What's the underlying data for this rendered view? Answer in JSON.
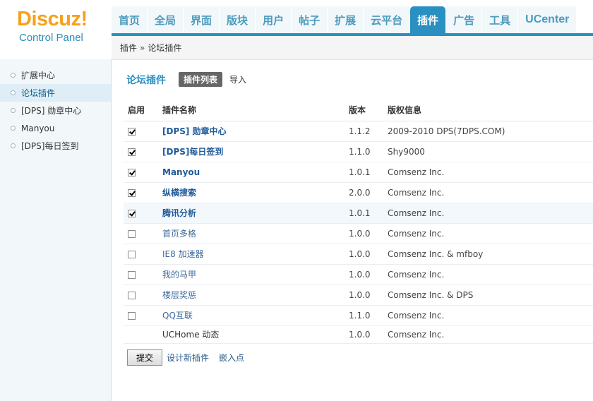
{
  "logo": {
    "word": "Discuz!",
    "sub": "Control Panel"
  },
  "nav": [
    {
      "label": "首页"
    },
    {
      "label": "全局"
    },
    {
      "label": "界面"
    },
    {
      "label": "版块"
    },
    {
      "label": "用户"
    },
    {
      "label": "帖子"
    },
    {
      "label": "扩展"
    },
    {
      "label": "云平台"
    },
    {
      "label": "插件",
      "active": true
    },
    {
      "label": "广告"
    },
    {
      "label": "工具"
    },
    {
      "label": "UCenter"
    }
  ],
  "breadcrumb": {
    "parent": "插件",
    "sep": "»",
    "current": "论坛插件"
  },
  "sidebar": {
    "items": [
      {
        "label": "扩展中心"
      },
      {
        "label": "论坛插件",
        "active": true
      },
      {
        "label": "[DPS] 勋章中心"
      },
      {
        "label": "Manyou"
      },
      {
        "label": "[DPS]每日签到"
      }
    ]
  },
  "main": {
    "title": "论坛插件",
    "tab_active": "插件列表",
    "tab_import": "导入",
    "columns": {
      "enabled": "启用",
      "name": "插件名称",
      "version": "版本",
      "copyright": "版权信息"
    },
    "rows": [
      {
        "name": "[DPS] 勋章中心",
        "version": "1.1.2",
        "copyright": "2009-2010 DPS(7DPS.COM)",
        "checked": true
      },
      {
        "name": "[DPS]每日签到",
        "version": "1.1.0",
        "copyright": "Shy9000",
        "checked": true
      },
      {
        "name": "Manyou",
        "version": "1.0.1",
        "copyright": "Comsenz Inc.",
        "checked": true
      },
      {
        "name": "纵横搜索",
        "version": "2.0.0",
        "copyright": "Comsenz Inc.",
        "checked": true
      },
      {
        "name": "腾讯分析",
        "version": "1.0.1",
        "copyright": "Comsenz Inc.",
        "checked": true
      },
      {
        "name": "首页多格",
        "version": "1.0.0",
        "copyright": "Comsenz Inc.",
        "checked": false
      },
      {
        "name": "IE8 加速器",
        "version": "1.0.0",
        "copyright": "Comsenz Inc. & mfboy",
        "checked": false
      },
      {
        "name": "我的马甲",
        "version": "1.0.0",
        "copyright": "Comsenz Inc.",
        "checked": false
      },
      {
        "name": "楼层奖惩",
        "version": "1.0.0",
        "copyright": "Comsenz Inc. & DPS",
        "checked": false
      },
      {
        "name": "QQ互联",
        "version": "1.1.0",
        "copyright": "Comsenz Inc.",
        "checked": false
      },
      {
        "name": "UCHome 动态",
        "version": "1.0.0",
        "copyright": "Comsenz Inc.",
        "checked": null
      }
    ],
    "submit_label": "提交",
    "design_link": "设计新插件",
    "hook_link": "嵌入点"
  }
}
